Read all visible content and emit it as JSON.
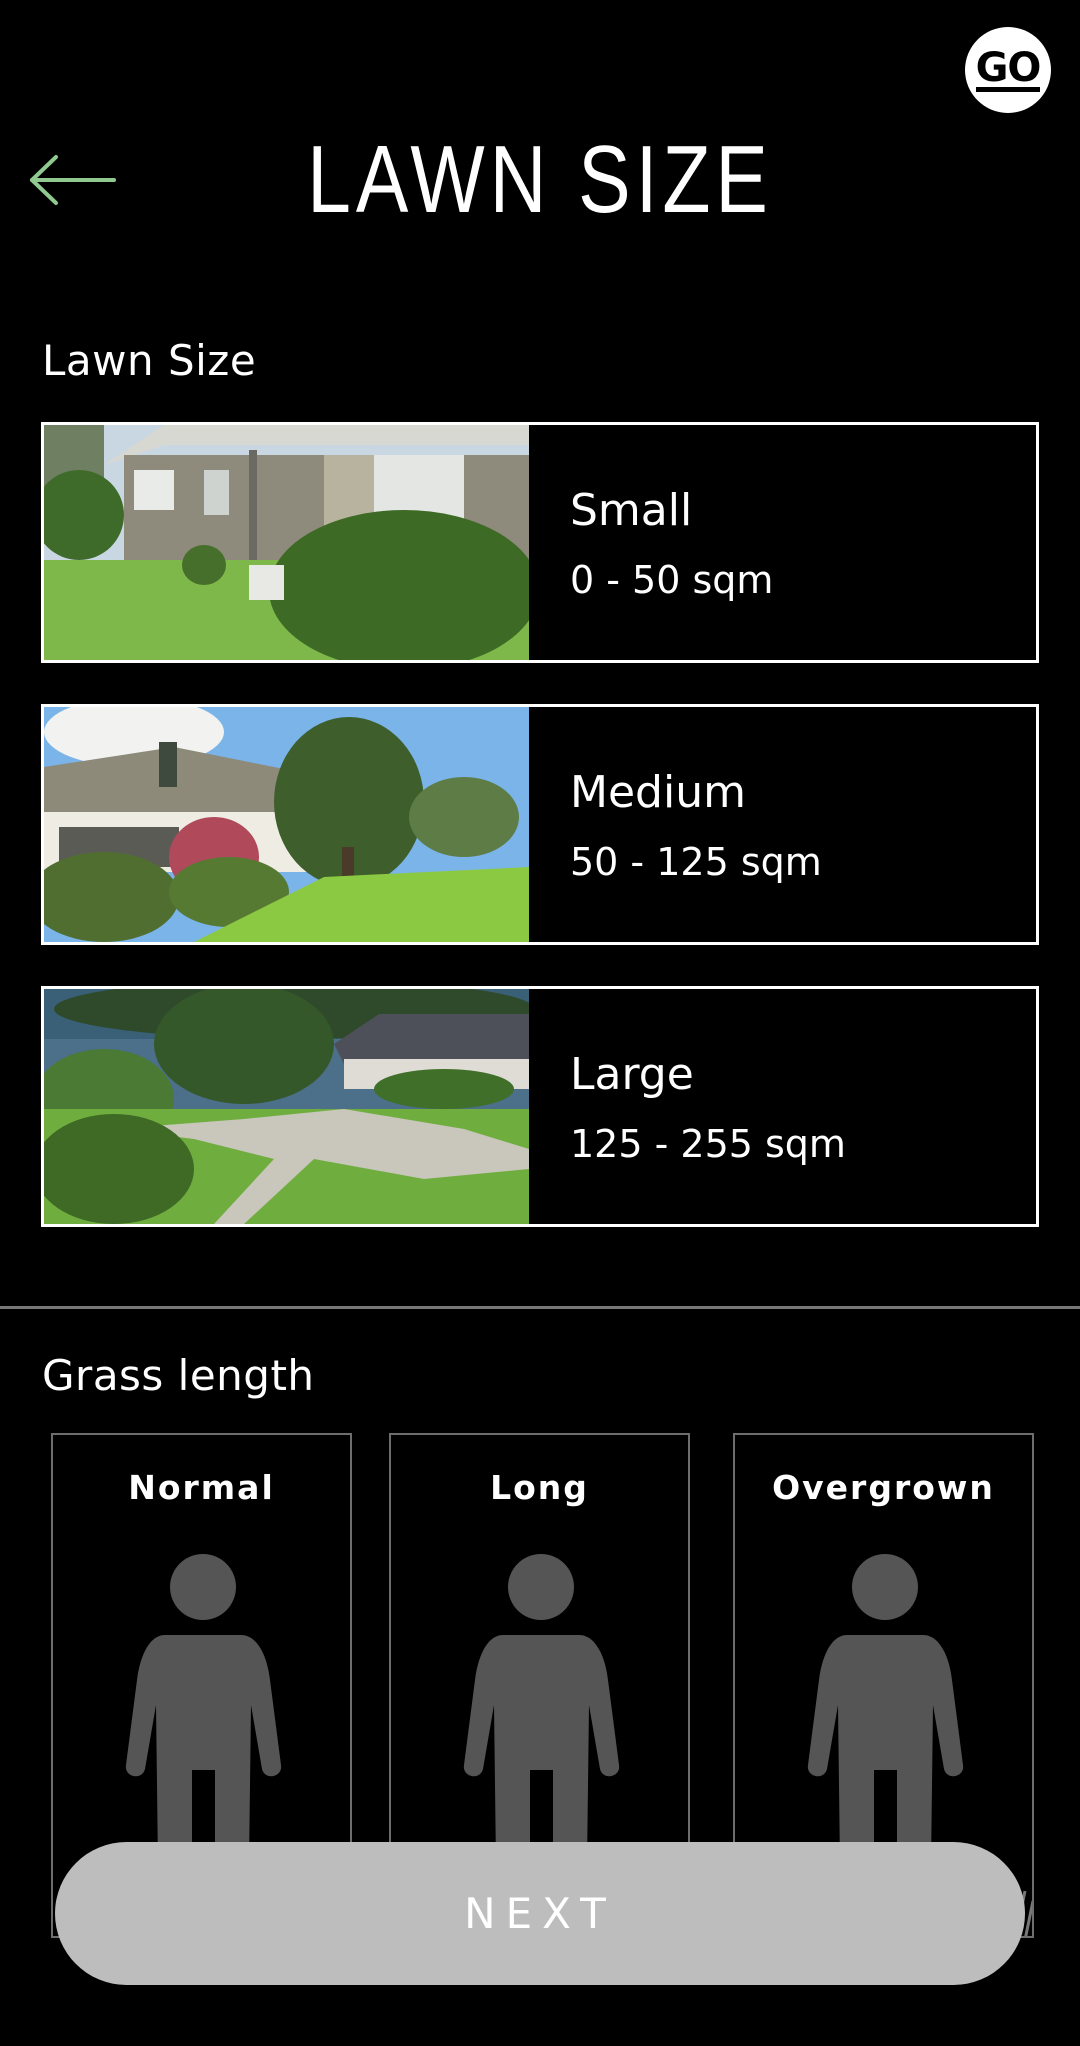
{
  "header": {
    "badge_text": "GO",
    "title": "LAWN SIZE",
    "back_icon": "arrow-left-icon",
    "accent_color": "#8fc98f"
  },
  "lawn_size": {
    "label": "Lawn Size",
    "options": [
      {
        "name": "Small",
        "range": "0 - 50 sqm"
      },
      {
        "name": "Medium",
        "range": "50 - 125 sqm"
      },
      {
        "name": "Large",
        "range": "125 - 255 sqm"
      }
    ]
  },
  "grass_length": {
    "label": "Grass length",
    "options": [
      {
        "name": "Normal",
        "icon": "person-icon"
      },
      {
        "name": "Long",
        "icon": "person-icon"
      },
      {
        "name": "Overgrown",
        "icon": "person-icon"
      }
    ]
  },
  "next_button": {
    "label": "NEXT",
    "color": "#bdbdbd"
  }
}
